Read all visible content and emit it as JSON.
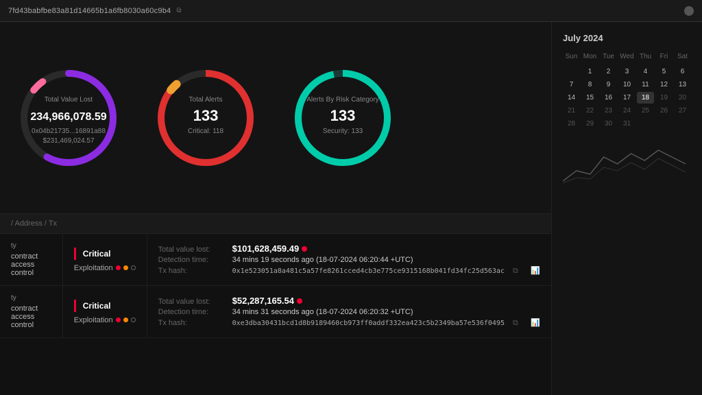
{
  "topbar": {
    "address": "7fd43babfbe83a81d14665b1a6fb8030a60c9b4",
    "copy_icon": "📋"
  },
  "gauges": [
    {
      "id": "total-value-lost",
      "label": "Total Value Lost",
      "value": "234,966,078.59",
      "sub1": "0x04b21735...16891a88",
      "sub2": "$231,469,024.57",
      "color_main": "#8b2be2",
      "color_secondary": "#ff6b9d",
      "dash_array": "310 410",
      "dash_array2": "30 410",
      "dash_offset": "0",
      "dash_offset2": "-310"
    },
    {
      "id": "total-alerts",
      "label": "Total Alerts",
      "value": "133",
      "sub1": "Critical: 118",
      "color_main": "#e03030",
      "color_secondary": "#f0a030",
      "dash_array": "340 410",
      "dash_array2": "30 410",
      "dash_offset": "0",
      "dash_offset2": "-340"
    },
    {
      "id": "alerts-by-risk",
      "label": "Alerts By Risk Category",
      "value": "133",
      "sub1": "Security: 133",
      "color_main": "#00ccaa",
      "dash_array": "390 410",
      "dash_offset": "0"
    }
  ],
  "breadcrumb": "/ Address / Tx",
  "alerts": [
    {
      "type": "ty",
      "name": "contract access control",
      "severity": "Critical",
      "category": "Exploitation",
      "dots": [
        "red",
        "orange",
        "outline"
      ],
      "total_value": "$101,628,459.49",
      "detection_time": "34 mins 19 seconds ago (18-07-2024 06:20:44 +UTC)",
      "tx_hash": "0x1e523051a8a481c5a57fe8261cced4cb3e775ce9315168b041fd34fc25d563ac"
    },
    {
      "type": "ty",
      "name": "contract access control",
      "severity": "Critical",
      "category": "Exploitation",
      "dots": [
        "red",
        "orange",
        "outline"
      ],
      "total_value": "$52,287,165.54",
      "detection_time": "34 mins 31 seconds ago (18-07-2024 06:20:32 +UTC)",
      "tx_hash": "0xe3dba30431bcd1d8b9189460cb973ff0addf332ea423c5b2349ba57e536f0495"
    }
  ],
  "calendar": {
    "month": "July 2024",
    "day_names": [
      "Sun",
      "Mon",
      "Tue",
      "Wed",
      "Thu",
      "Fri",
      "Sat"
    ],
    "days": [
      {
        "n": "",
        "active": false
      },
      {
        "n": "1",
        "active": true
      },
      {
        "n": "2",
        "active": true
      },
      {
        "n": "3",
        "active": true
      },
      {
        "n": "4",
        "active": true
      },
      {
        "n": "5",
        "active": true
      },
      {
        "n": "6",
        "active": true
      },
      {
        "n": "7",
        "active": true
      },
      {
        "n": "8",
        "active": true
      },
      {
        "n": "9",
        "active": true
      },
      {
        "n": "10",
        "active": true
      },
      {
        "n": "11",
        "active": true
      },
      {
        "n": "12",
        "active": true
      },
      {
        "n": "13",
        "active": true
      },
      {
        "n": "14",
        "active": true
      },
      {
        "n": "15",
        "active": true
      },
      {
        "n": "16",
        "active": true
      },
      {
        "n": "17",
        "active": true
      },
      {
        "n": "18",
        "active": true,
        "today": true
      },
      {
        "n": "19",
        "active": false
      },
      {
        "n": "20",
        "active": false
      },
      {
        "n": "21",
        "active": false
      },
      {
        "n": "22",
        "active": false
      },
      {
        "n": "23",
        "active": false
      },
      {
        "n": "24",
        "active": false
      },
      {
        "n": "25",
        "active": false
      },
      {
        "n": "26",
        "active": false
      },
      {
        "n": "27",
        "active": false
      },
      {
        "n": "28",
        "active": false
      },
      {
        "n": "29",
        "active": false
      },
      {
        "n": "30",
        "active": false
      },
      {
        "n": "31",
        "active": false
      }
    ]
  },
  "labels": {
    "total_value": "Total value lost:",
    "detection_time": "Detection time:",
    "tx_hash": "Tx hash:"
  }
}
